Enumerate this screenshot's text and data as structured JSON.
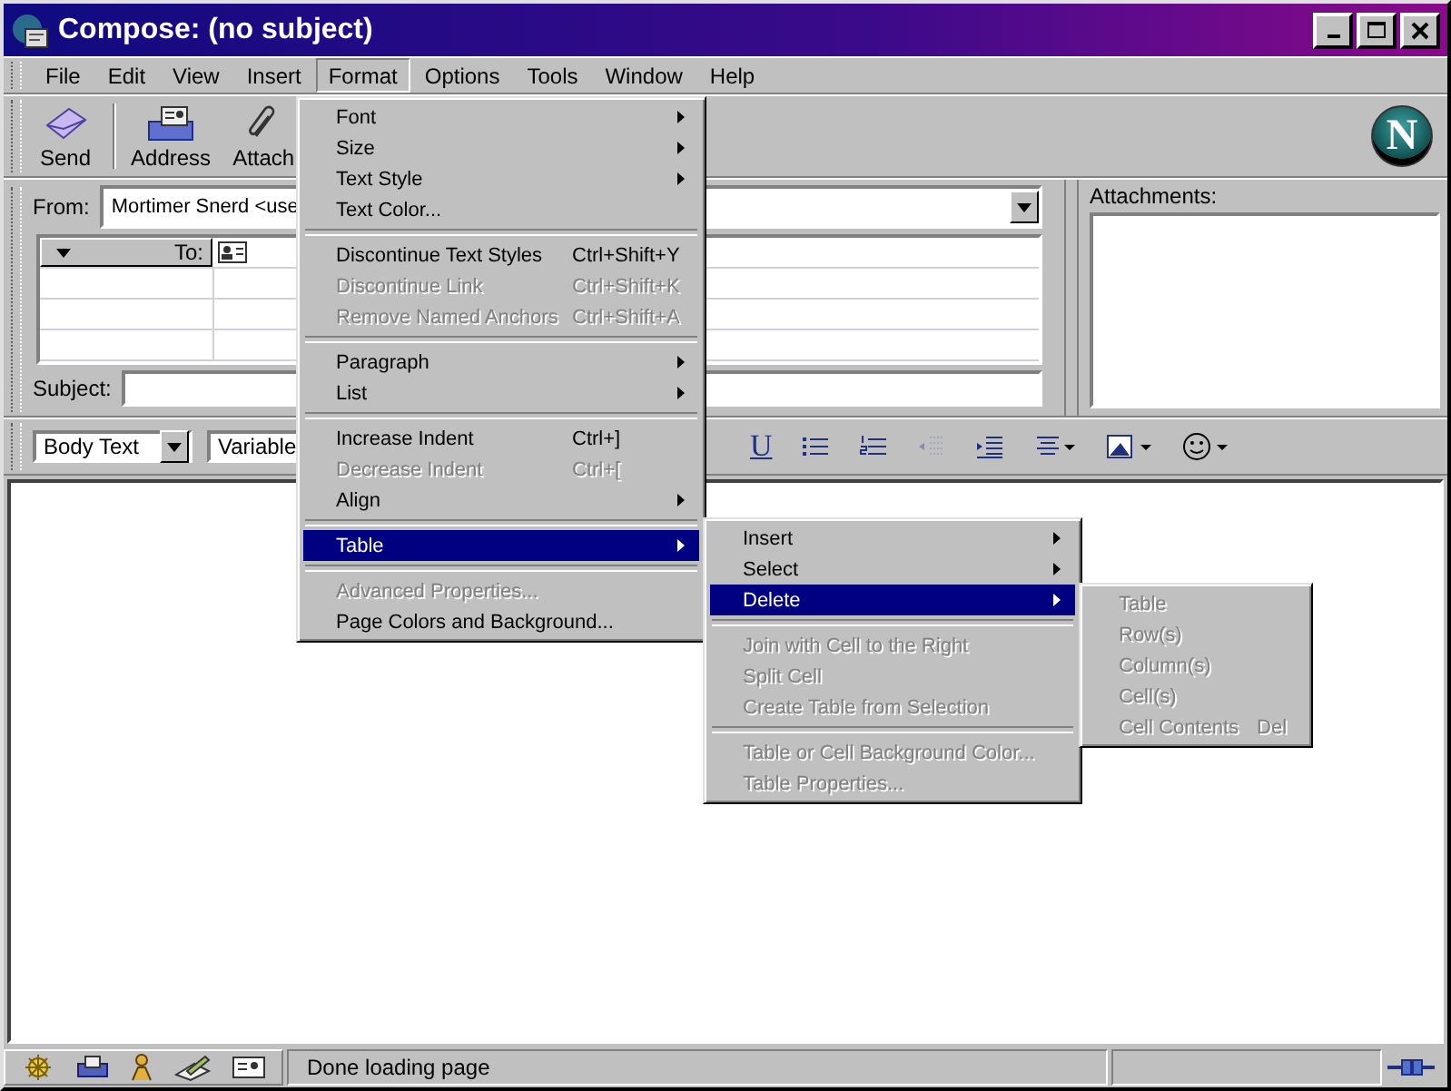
{
  "window": {
    "title": "Compose: (no subject)"
  },
  "menubar": [
    {
      "label": "File",
      "selected": false
    },
    {
      "label": "Edit",
      "selected": false
    },
    {
      "label": "View",
      "selected": false
    },
    {
      "label": "Insert",
      "selected": false
    },
    {
      "label": "Format",
      "selected": true
    },
    {
      "label": "Options",
      "selected": false
    },
    {
      "label": "Tools",
      "selected": false
    },
    {
      "label": "Window",
      "selected": false
    },
    {
      "label": "Help",
      "selected": false
    }
  ],
  "toolbar": {
    "buttons": [
      {
        "label": "Send",
        "kind": "send"
      },
      {
        "label": "Address",
        "kind": "address"
      },
      {
        "label": "Attach",
        "kind": "attach"
      }
    ],
    "logo": "N"
  },
  "address": {
    "from_label": "From:",
    "from_value": "Mortimer Snerd <use",
    "to_label": "To:",
    "subject_label": "Subject:"
  },
  "attachments": {
    "label": "Attachments:"
  },
  "format_toolbar": {
    "paragraph_style": "Body Text",
    "font": "Variable",
    "underline": "U"
  },
  "format_menu": [
    {
      "kind": "item",
      "label": "Font",
      "submenu": true,
      "disabled": false,
      "selected": false
    },
    {
      "kind": "item",
      "label": "Size",
      "submenu": true,
      "disabled": false,
      "selected": false
    },
    {
      "kind": "item",
      "label": "Text Style",
      "submenu": true,
      "disabled": false,
      "selected": false
    },
    {
      "kind": "item",
      "label": "Text Color...",
      "submenu": false,
      "disabled": false,
      "selected": false
    },
    {
      "kind": "separator"
    },
    {
      "kind": "item",
      "label": "Discontinue Text Styles",
      "shortcut": "Ctrl+Shift+Y",
      "submenu": false,
      "disabled": false,
      "selected": false
    },
    {
      "kind": "item",
      "label": "Discontinue Link",
      "shortcut": "Ctrl+Shift+K",
      "submenu": false,
      "disabled": true,
      "selected": false
    },
    {
      "kind": "item",
      "label": "Remove Named Anchors",
      "shortcut": "Ctrl+Shift+A",
      "submenu": false,
      "disabled": true,
      "selected": false
    },
    {
      "kind": "separator"
    },
    {
      "kind": "item",
      "label": "Paragraph",
      "submenu": true,
      "disabled": false,
      "selected": false
    },
    {
      "kind": "item",
      "label": "List",
      "submenu": true,
      "disabled": false,
      "selected": false
    },
    {
      "kind": "separator"
    },
    {
      "kind": "item",
      "label": "Increase Indent",
      "shortcut": "Ctrl+]",
      "submenu": false,
      "disabled": false,
      "selected": false
    },
    {
      "kind": "item",
      "label": "Decrease Indent",
      "shortcut": "Ctrl+[",
      "submenu": false,
      "disabled": true,
      "selected": false
    },
    {
      "kind": "item",
      "label": "Align",
      "submenu": true,
      "disabled": false,
      "selected": false
    },
    {
      "kind": "separator"
    },
    {
      "kind": "item",
      "label": "Table",
      "submenu": true,
      "disabled": false,
      "selected": true
    },
    {
      "kind": "separator"
    },
    {
      "kind": "item",
      "label": "Advanced Properties...",
      "submenu": false,
      "disabled": true,
      "selected": false
    },
    {
      "kind": "item",
      "label": "Page Colors and Background...",
      "submenu": false,
      "disabled": false,
      "selected": false
    }
  ],
  "table_menu": [
    {
      "kind": "item",
      "label": "Insert",
      "submenu": true,
      "disabled": false,
      "selected": false
    },
    {
      "kind": "item",
      "label": "Select",
      "submenu": true,
      "disabled": false,
      "selected": false
    },
    {
      "kind": "item",
      "label": "Delete",
      "submenu": true,
      "disabled": false,
      "selected": true
    },
    {
      "kind": "separator"
    },
    {
      "kind": "item",
      "label": "Join with Cell to the Right",
      "submenu": false,
      "disabled": true,
      "selected": false
    },
    {
      "kind": "item",
      "label": "Split Cell",
      "submenu": false,
      "disabled": true,
      "selected": false
    },
    {
      "kind": "item",
      "label": "Create Table from Selection",
      "submenu": false,
      "disabled": true,
      "selected": false
    },
    {
      "kind": "separator"
    },
    {
      "kind": "item",
      "label": "Table or Cell Background Color...",
      "submenu": false,
      "disabled": true,
      "selected": false
    },
    {
      "kind": "item",
      "label": "Table Properties...",
      "submenu": false,
      "disabled": true,
      "selected": false
    }
  ],
  "delete_menu": [
    {
      "kind": "item",
      "label": "Table",
      "submenu": false,
      "disabled": true,
      "selected": false
    },
    {
      "kind": "item",
      "label": "Row(s)",
      "submenu": false,
      "disabled": true,
      "selected": false
    },
    {
      "kind": "item",
      "label": "Column(s)",
      "submenu": false,
      "disabled": true,
      "selected": false
    },
    {
      "kind": "item",
      "label": "Cell(s)",
      "submenu": false,
      "disabled": true,
      "selected": false
    },
    {
      "kind": "item",
      "label": "Cell Contents",
      "shortcut": "Del",
      "submenu": false,
      "disabled": true,
      "selected": false
    }
  ],
  "status_bar": {
    "text": "Done loading page"
  }
}
